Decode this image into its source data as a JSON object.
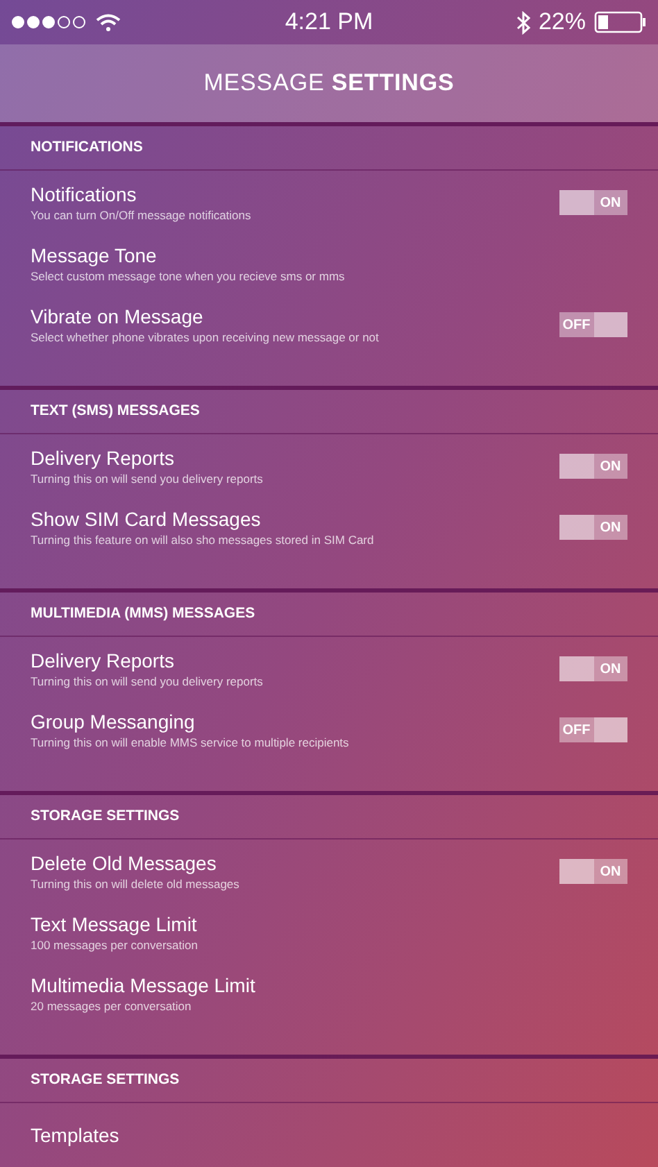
{
  "status_bar": {
    "time": "4:21 PM",
    "battery": "22%"
  },
  "header": {
    "title": "MESSAGE **SETTINGS**"
  },
  "sections": [
    {
      "title": "NOTIFICATIONS",
      "items": [
        {
          "kind": "toggle",
          "title": "Notifications",
          "subtitle": "You can turn On/Off message notifications",
          "on": true,
          "toggle_label": "ON"
        },
        {
          "kind": "plain",
          "title": "Message Tone",
          "subtitle": "Select custom message tone when you recieve sms or mms"
        },
        {
          "kind": "toggle",
          "title": "Vibrate on Message",
          "subtitle": "Select whether phone vibrates upon receiving new message or not",
          "on": false,
          "toggle_label": "OFF"
        }
      ]
    },
    {
      "title": "TEXT (SMS) MESSAGES",
      "items": [
        {
          "kind": "toggle",
          "title": "Delivery Reports",
          "subtitle": "Turning this on will send you delivery reports",
          "on": true,
          "toggle_label": "ON"
        },
        {
          "kind": "toggle",
          "title": "Show SIM Card Messages",
          "subtitle": "Turning this feature on will also sho messages stored in SIM Card",
          "on": true,
          "toggle_label": "ON"
        }
      ]
    },
    {
      "title": "MULTIMEDIA (MMS) MESSAGES",
      "items": [
        {
          "kind": "toggle",
          "title": "Delivery Reports",
          "subtitle": "Turning this on will send you delivery reports",
          "on": true,
          "toggle_label": "ON"
        },
        {
          "kind": "toggle",
          "title": "Group Messanging",
          "subtitle": "Turning this on will enable MMS service to multiple recipients",
          "on": false,
          "toggle_label": "OFF"
        }
      ]
    },
    {
      "title": "STORAGE SETTINGS",
      "items": [
        {
          "kind": "toggle",
          "title": "Delete Old Messages",
          "subtitle": "Turning this on will delete old messages",
          "on": true,
          "toggle_label": "ON"
        },
        {
          "kind": "plain",
          "title": "Text Message Limit",
          "subtitle": "100 messages per conversation"
        },
        {
          "kind": "plain",
          "title": "Multimedia Message Limit",
          "subtitle": "20 messages per conversation"
        }
      ]
    },
    {
      "title": "STORAGE SETTINGS",
      "items": [
        {
          "kind": "plain",
          "title": "Templates"
        }
      ]
    }
  ]
}
